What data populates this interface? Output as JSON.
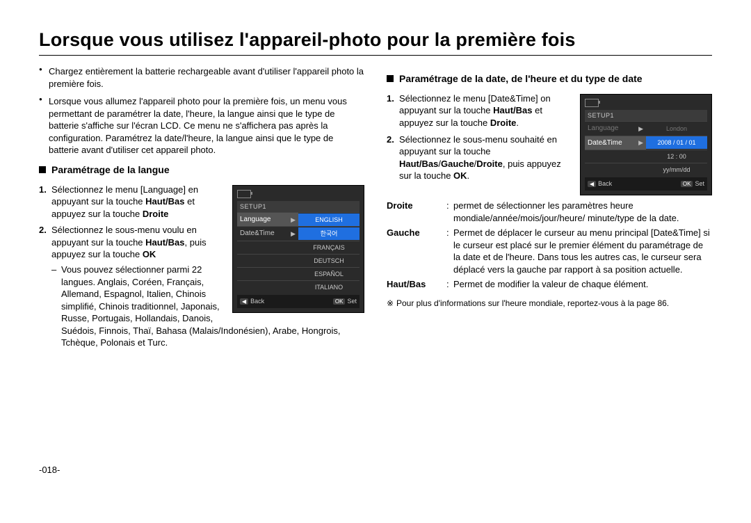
{
  "title": "Lorsque vous utilisez l'appareil-photo pour la première fois",
  "page_number": "-018-",
  "intro": [
    "Chargez entièrement la batterie rechargeable avant d'utiliser l'appareil photo la première fois.",
    "Lorsque vous allumez l'appareil photo pour la première fois, un menu vous permettant de paramétrer la date, l'heure, la langue ainsi que le type de batterie s'affiche sur l'écran LCD. Ce menu ne s'affichera pas après la configuration. Paramétrez la date/l'heure, la langue ainsi que le type de batterie avant d'utiliser cet appareil photo."
  ],
  "left": {
    "heading": "Paramétrage de la langue",
    "step1_pre": "Sélectionnez le menu [Language] en appuyant sur la touche ",
    "step1_b1": "Haut/Bas",
    "step1_mid": " et appuyez sur la touche ",
    "step1_b2": "Droite",
    "step2_pre": "Sélectionnez le sous-menu voulu en appuyant sur la touche ",
    "step2_b1": "Haut/Bas",
    "step2_mid": ", puis appuyez sur la touche ",
    "step2_b2": "OK",
    "sub": "Vous pouvez sélectionner parmi 22 langues. Anglais, Coréen, Français, Allemand, Espagnol, Italien, Chinois simplifié, Chinois traditionnel, Japonais, Russe, Portugais, Hollandais, Danois, Suédois, Finnois, Thaï, Bahasa (Malais/Indonésien), Arabe, Hongrois, Tchèque, Polonais et Turc."
  },
  "right": {
    "heading": "Paramétrage de la date, de l'heure et du type de date",
    "step1_pre": "Sélectionnez le menu [Date&Time] on appuyant sur la touche ",
    "step1_b1": "Haut/Bas",
    "step1_mid": " et appuyez sur la touche ",
    "step1_b2": "Droite",
    "step1_post": ".",
    "step2_pre": "Sélectionnez le sous-menu souhaité en appuyant sur la touche ",
    "step2_b1": "Haut/Bas",
    "step2_sep1": "/",
    "step2_b2": "Gauche",
    "step2_sep2": "/",
    "step2_b3": "Droite",
    "step2_mid": ", puis appuyez sur la touche ",
    "step2_b4": "OK",
    "step2_post": ".",
    "defs": {
      "droite_k": "Droite",
      "droite_v": "permet de sélectionner les paramètres heure mondiale/année/mois/jour/heure/ minute/type de la date.",
      "gauche_k": "Gauche",
      "gauche_v": "Permet de déplacer le curseur au menu principal [Date&Time] si le curseur est placé sur le premier élément du paramétrage de la date et de l'heure. Dans tous les autres cas, le curseur sera déplacé vers la gauche par rapport à sa position actuelle.",
      "hautbas_k": "Haut/Bas",
      "hautbas_v": "Permet de modifier la valeur de chaque élément."
    },
    "note": "Pour plus d'informations sur l'heure mondiale, reportez-vous à la page 86."
  },
  "lcd_lang": {
    "setup": "SETUP1",
    "menu1": "Language",
    "menu2": "Date&Time",
    "opts": [
      "ENGLISH",
      "한국어",
      "FRANÇAIS",
      "DEUTSCH",
      "ESPAÑOL",
      "ITALIANO"
    ],
    "back": "Back",
    "ok": "OK",
    "set": "Set"
  },
  "lcd_date": {
    "setup": "SETUP1",
    "menu1": "Language",
    "menu1_val": "London",
    "menu2": "Date&Time",
    "line1": "2008 / 01 / 01",
    "line2": "12 : 00",
    "line3": "yy/mm/dd",
    "back": "Back",
    "ok": "OK",
    "set": "Set"
  }
}
